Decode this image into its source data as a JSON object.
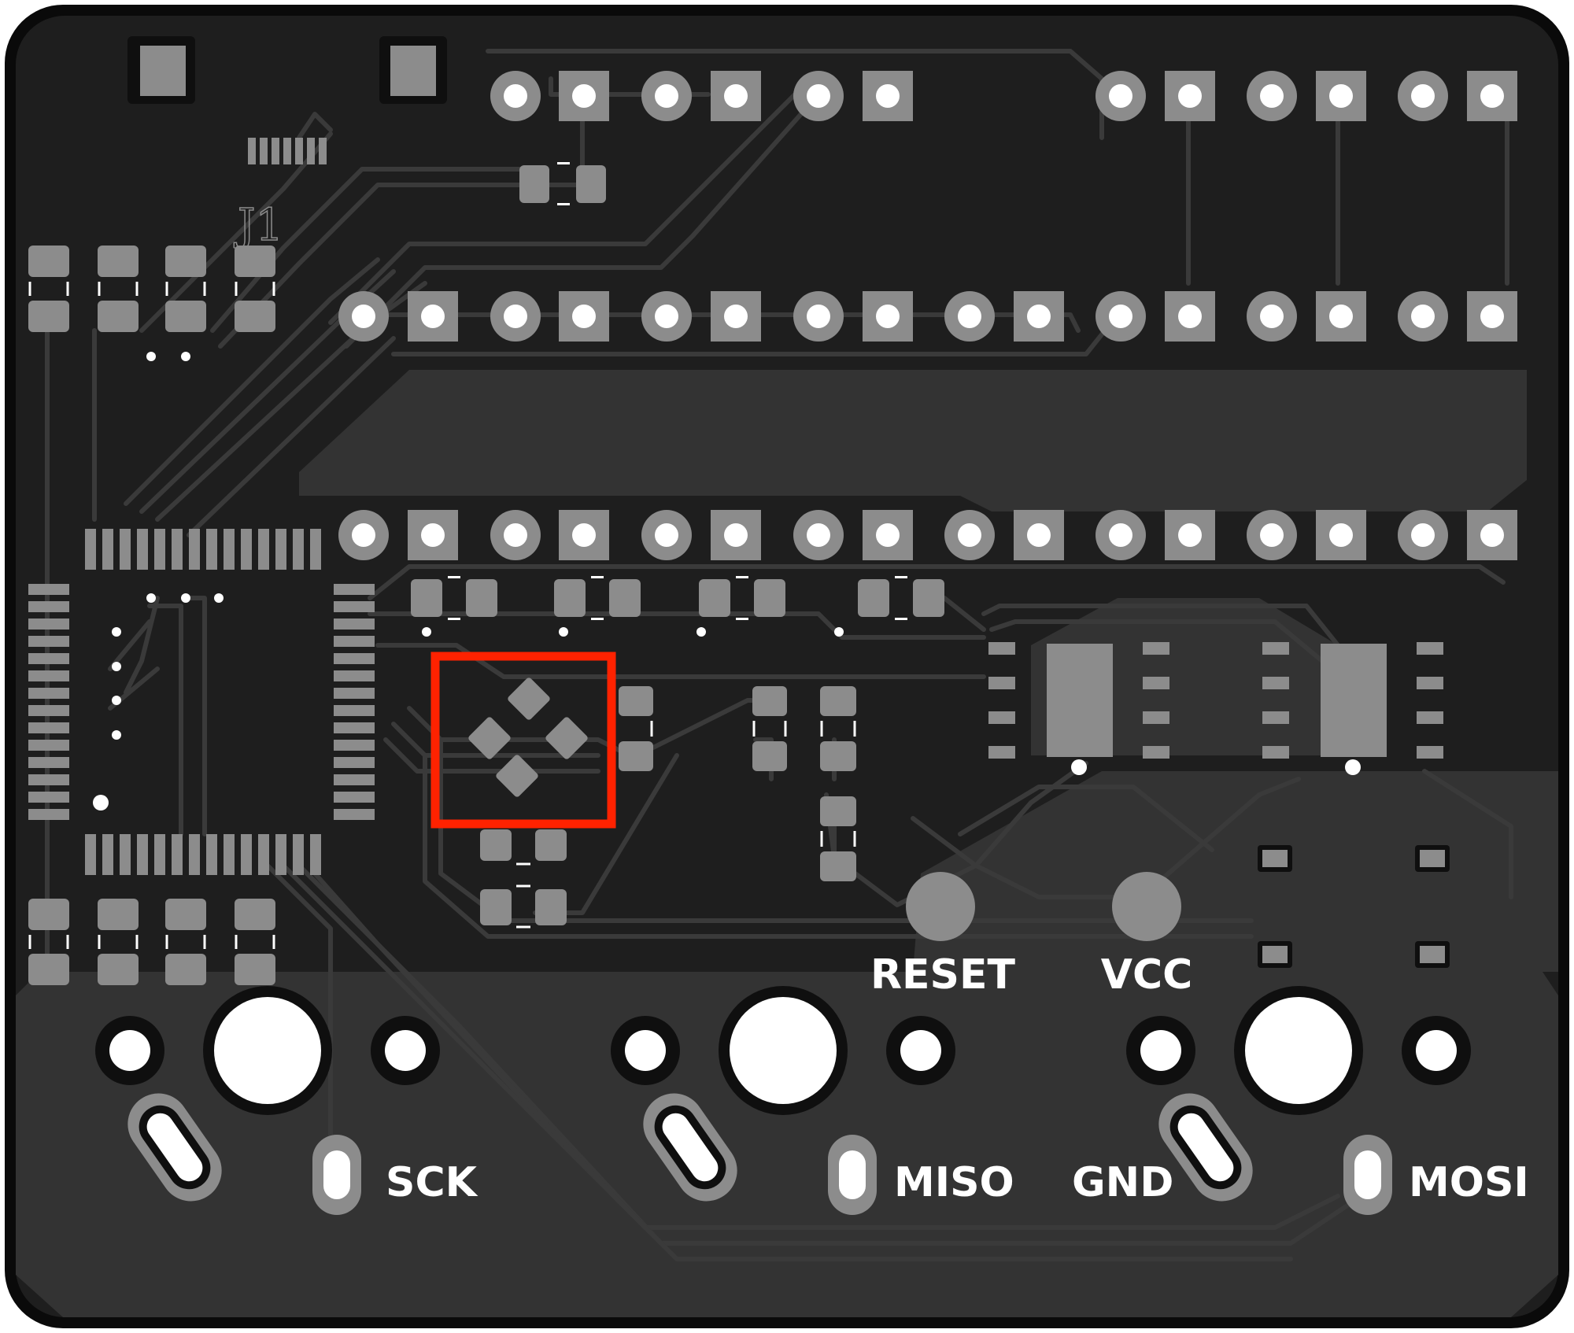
{
  "board": {
    "reference": "J1",
    "colors": {
      "substrate": "#1e1e1e",
      "outline": "#0a0a0a",
      "copper_fill": "#333333",
      "trace": "#3a3a3a",
      "pad": "#8c8c8c",
      "drill": "#ffffff",
      "silkscreen": "#ffffff",
      "highlight": "#ff2200"
    },
    "labels": {
      "sck": "SCK",
      "miso": "MISO",
      "gnd": "GND",
      "mosi": "MOSI",
      "reset": "RESET",
      "vcc": "VCC"
    },
    "highlight": {
      "component": "tactile-switch-4pad",
      "color": "#ff2200"
    }
  }
}
